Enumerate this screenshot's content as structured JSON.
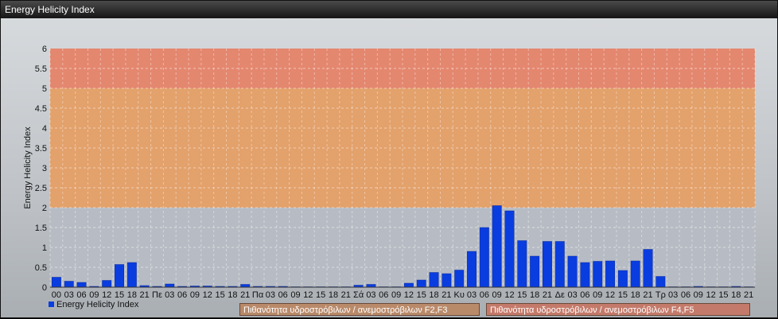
{
  "window": {
    "title": "Energy Helicity Index"
  },
  "chart_data": {
    "type": "bar",
    "title": "",
    "ylabel": "Energy Helicity Index",
    "xlabel": "",
    "ylim": [
      0,
      6
    ],
    "yticks": [
      "0",
      "0.5",
      "1",
      "1.5",
      "2",
      "2.5",
      "3",
      "3.5",
      "4",
      "4.5",
      "5",
      "5.5",
      "6"
    ],
    "categories": [
      "00",
      "03",
      "06",
      "09",
      "12",
      "15",
      "18",
      "21",
      "Πε",
      "03",
      "06",
      "09",
      "12",
      "15",
      "18",
      "21",
      "Πα",
      "03",
      "06",
      "09",
      "12",
      "15",
      "18",
      "21",
      "Σά",
      "03",
      "06",
      "09",
      "12",
      "15",
      "18",
      "21",
      "Κυ",
      "03",
      "06",
      "09",
      "12",
      "15",
      "18",
      "21",
      "Δε",
      "03",
      "06",
      "09",
      "12",
      "15",
      "18",
      "21",
      "Τρ",
      "03",
      "06",
      "09",
      "12",
      "15",
      "18",
      "21"
    ],
    "series": [
      {
        "name": "Energy Helicity Index",
        "color": "#0a3de0",
        "values": [
          0.25,
          0.15,
          0.12,
          0.02,
          0.17,
          0.57,
          0.62,
          0.04,
          0.02,
          0.08,
          0.02,
          0.03,
          0.03,
          0.02,
          0.02,
          0.07,
          0.02,
          0.02,
          0.02,
          0.01,
          0.01,
          0.01,
          0.01,
          0.01,
          0.05,
          0.07,
          0.01,
          0.01,
          0.1,
          0.18,
          0.37,
          0.34,
          0.43,
          0.9,
          1.5,
          2.05,
          1.92,
          1.17,
          0.78,
          1.15,
          1.15,
          0.78,
          0.62,
          0.65,
          0.66,
          0.42,
          0.66,
          0.95,
          0.27,
          0.01,
          0.01,
          0.02,
          0.01,
          0.01,
          0.02,
          0.01
        ]
      }
    ],
    "bands": [
      {
        "from": 0,
        "to": 2,
        "color": "#b7bcc4"
      },
      {
        "from": 2,
        "to": 5,
        "color": "#e3a16b"
      },
      {
        "from": 5,
        "to": 6,
        "color": "#e4876f"
      }
    ],
    "legend": {
      "position": "bottom-left"
    },
    "grid": true
  },
  "band_labels": [
    {
      "text": "Πιθανότητα υδροστρόβιλων / ανεμοστρόβιλων F2,F3",
      "color": "#b98a6a"
    },
    {
      "text": "Πιθανότητα υδροστρόβιλων / ανεμοστρόβιλων F4,F5",
      "color": "#c47a6a"
    }
  ]
}
